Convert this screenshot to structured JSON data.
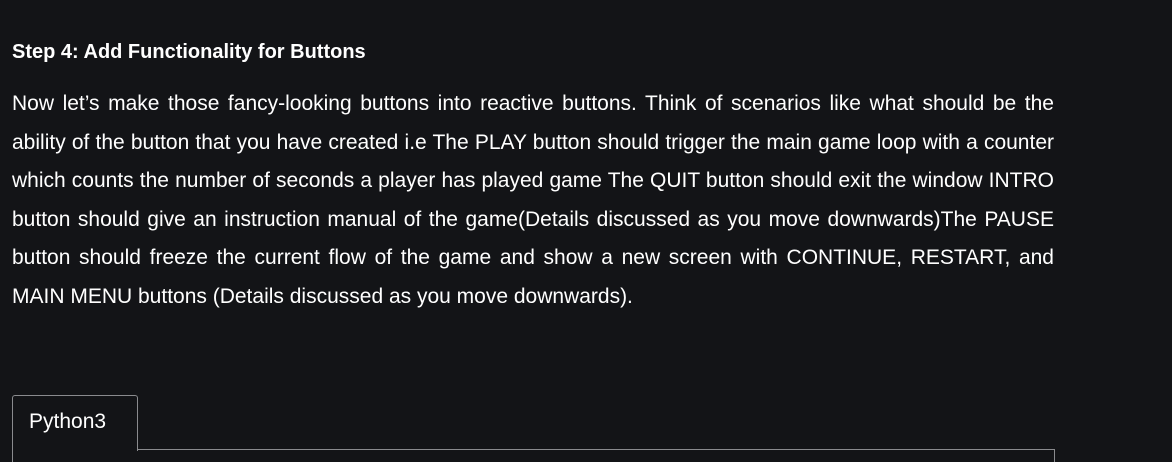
{
  "article": {
    "step_heading": "Step 4:  Add Functionality for Buttons",
    "paragraph": "Now let’s make those fancy-looking buttons into reactive buttons. Think of scenarios like what should be  the ability of the button that you have created i.e The PLAY button should trigger the main game loop with a counter which counts the number of seconds a player has played game The QUIT button should exit the window INTRO button should give an instruction manual of the game(Details discussed as you move downwards)The PAUSE button should freeze the current flow of the game and show a new screen with CONTINUE, RESTART, and MAIN MENU buttons (Details discussed as you move downwards)."
  },
  "code_block": {
    "tabs": [
      {
        "label": "Python3",
        "active": true
      }
    ]
  },
  "colors": {
    "background": "#131417",
    "text": "#ffffff",
    "border": "#8a8b8e"
  }
}
